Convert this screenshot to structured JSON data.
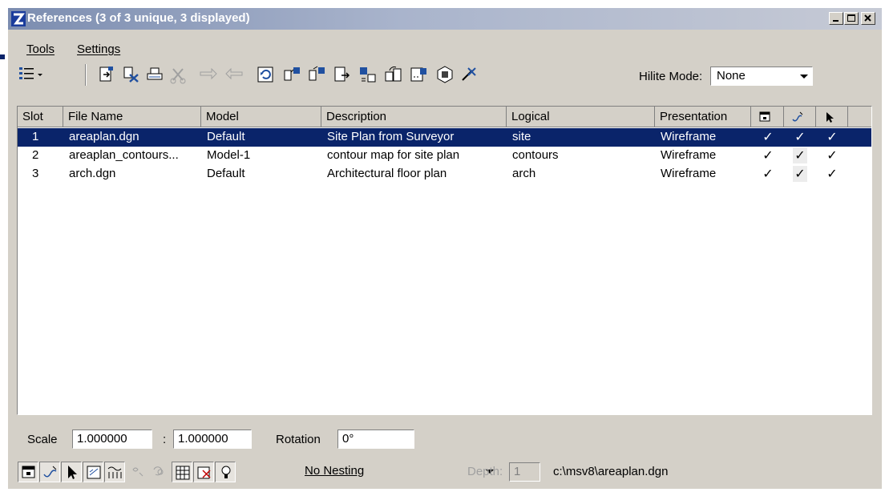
{
  "window": {
    "title": "References (3 of 3 unique, 3 displayed)",
    "controls": [
      "minimize",
      "maximize",
      "close"
    ]
  },
  "menu": {
    "tools": "Tools",
    "settings": "Settings"
  },
  "toolbar": {
    "hilite_label": "Hilite Mode:",
    "hilite_value": "None",
    "icons": [
      "list-options-icon",
      "attach-reference-icon",
      "detach-reference-icon",
      "print-icon",
      "clip-icon",
      "move-icon",
      "copy-icon",
      "reload-icon",
      "attach-copy-icon",
      "rotate-icon",
      "scale-icon",
      "mirror-icon",
      "clip-boundary-icon",
      "clip-mask-icon",
      "settings-icon",
      "close-reference-icon"
    ]
  },
  "table": {
    "columns": [
      "Slot",
      "File Name",
      "Model",
      "Description",
      "Logical",
      "Presentation"
    ],
    "icon_columns": [
      "display-icon",
      "snap-icon",
      "locate-icon"
    ],
    "rows": [
      {
        "slot": "1",
        "file": "areaplan.dgn",
        "model": "Default",
        "description": "Site Plan from Surveyor",
        "logical": "site",
        "presentation": "Wireframe",
        "display": "✓",
        "snap": "✓",
        "locate": "✓",
        "selected": true
      },
      {
        "slot": "2",
        "file": "areaplan_contours...",
        "model": "Model-1",
        "description": "contour map for site plan",
        "logical": "contours",
        "presentation": "Wireframe",
        "display": "✓",
        "snap": "✓",
        "locate": "✓",
        "selected": false
      },
      {
        "slot": "3",
        "file": "arch.dgn",
        "model": "Default",
        "description": "Architectural floor plan",
        "logical": "arch",
        "presentation": "Wireframe",
        "display": "✓",
        "snap": "✓",
        "locate": "✓",
        "selected": false
      }
    ]
  },
  "bottom": {
    "scale_label": "Scale",
    "scale_master": "1.000000",
    "scale_sep": ":",
    "scale_ref": "1.000000",
    "rotation_label": "Rotation",
    "rotation_value": "0°",
    "nesting_value": "No Nesting",
    "depth_label": "Depth:",
    "depth_value": "1",
    "path": "c:\\msv8\\areaplan.dgn"
  },
  "colors": {
    "selection": "#0a246a",
    "face": "#d4d0c8",
    "title_start": "#7c8db0"
  }
}
